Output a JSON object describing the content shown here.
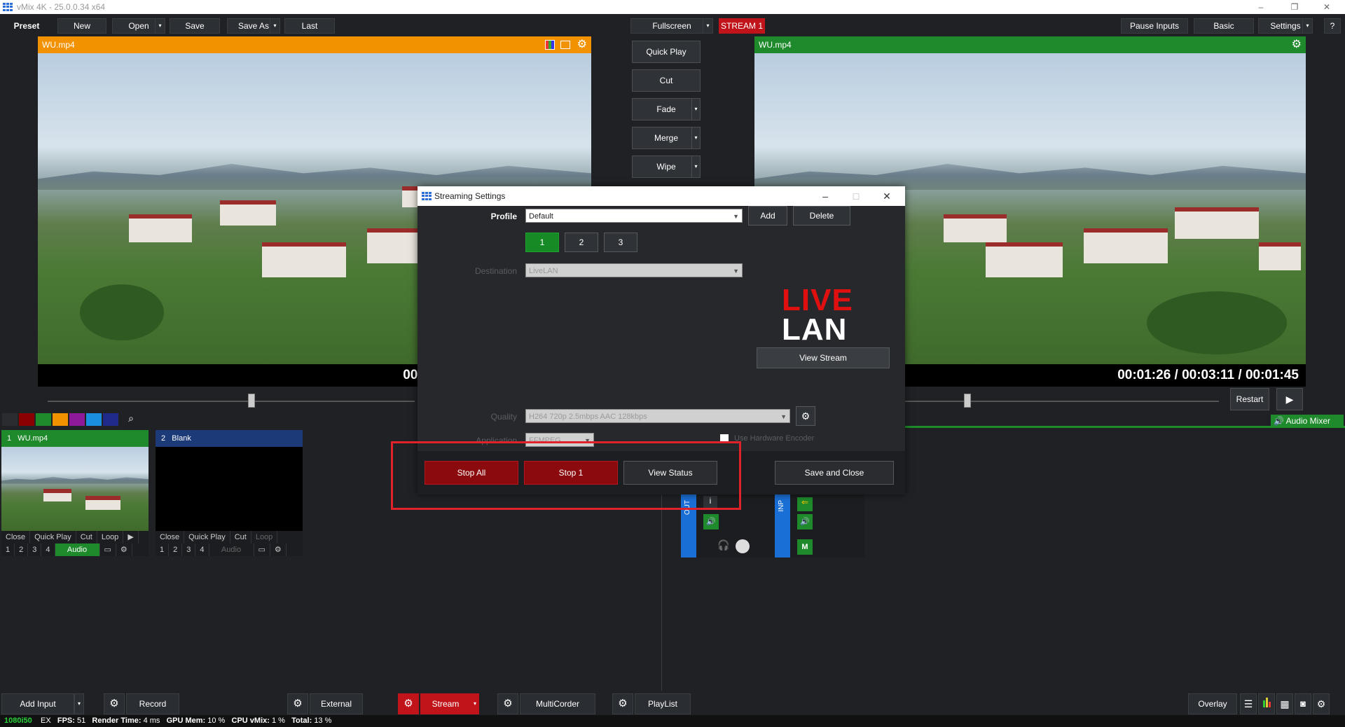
{
  "window": {
    "title": "vMix 4K - 25.0.0.34 x64"
  },
  "toolbar": {
    "preset": "Preset",
    "new": "New",
    "open": "Open",
    "save": "Save",
    "save_as": "Save As",
    "last": "Last",
    "fullscreen": "Fullscreen",
    "stream_badge": "STREAM 1",
    "pause_inputs": "Pause Inputs",
    "basic": "Basic",
    "settings": "Settings",
    "help": "?"
  },
  "preview": {
    "title": "WU.mp4",
    "time": "00:01:26  /  00:03:11  /  00:01:45"
  },
  "program": {
    "title": "WU.mp4",
    "time": "00:01:26  /  00:03:11  /  00:01:45",
    "restart": "Restart",
    "audio_mixer": "Audio Mixer"
  },
  "transitions": {
    "quick_play": "Quick Play",
    "cut": "Cut",
    "fade": "Fade",
    "merge": "Merge",
    "wipe": "Wipe"
  },
  "inputs": [
    {
      "number": "1",
      "name": "WU.mp4",
      "controls": [
        "Close",
        "Quick Play",
        "Cut",
        "Loop"
      ],
      "nums": [
        "1",
        "2",
        "3",
        "4"
      ],
      "audio": "Audio"
    },
    {
      "number": "2",
      "name": "Blank",
      "controls": [
        "Close",
        "Quick Play",
        "Cut",
        "Loop"
      ],
      "nums": [
        "1",
        "2",
        "3",
        "4"
      ],
      "audio": "Audio"
    }
  ],
  "colors": {
    "accent_orange": "#f39200",
    "accent_green": "#1e8a2b",
    "stream_red": "#c0141a"
  },
  "dialog": {
    "title": "Streaming Settings",
    "profile_label": "Profile",
    "profile_value": "Default",
    "add": "Add",
    "delete": "Delete",
    "tabs": [
      "1",
      "2",
      "3"
    ],
    "destination_label": "Destination",
    "destination_value": "LiveLAN",
    "logo_top": "LIVE",
    "logo_bottom": "LAN",
    "view_stream": "View Stream",
    "quality_label": "Quality",
    "quality_value": "H264 720p 2.5mbps AAC 128kbps",
    "application_label": "Application",
    "application_value": "FFMPEG",
    "hw_encoder": "Use Hardware Encoder",
    "stop_all": "Stop All",
    "stop_1": "Stop 1",
    "view_status": "View Status",
    "save_close": "Save and Close"
  },
  "mixer": {
    "out_label": "OUT",
    "inp_label": "INP",
    "mute": "M"
  },
  "bottom": {
    "add_input": "Add Input",
    "record": "Record",
    "external": "External",
    "stream": "Stream",
    "multicorder": "MultiCorder",
    "playlist": "PlayList",
    "overlay": "Overlay"
  },
  "status": {
    "res": "1080i50",
    "ex": "EX",
    "fps_label": "FPS:",
    "fps": "51",
    "render_label": "Render Time:",
    "render": "4 ms",
    "gpu_label": "GPU Mem:",
    "gpu": "10 %",
    "cpu_label": "CPU vMix:",
    "cpu": "1 %",
    "total_label": "Total:",
    "total": "13 %"
  }
}
